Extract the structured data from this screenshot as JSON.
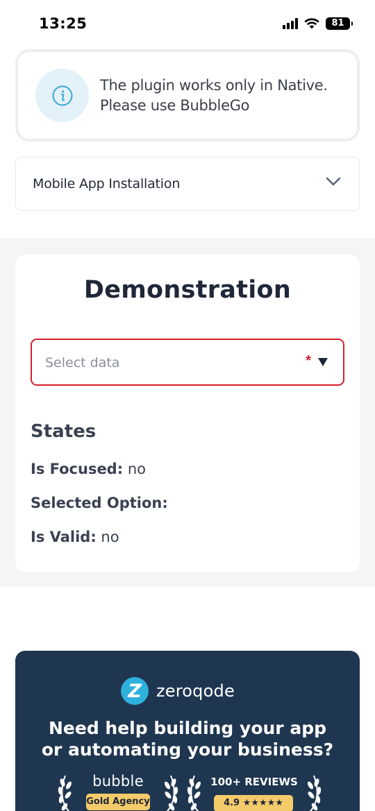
{
  "status_bar": {
    "time": "13:25",
    "battery": "81",
    "icons": [
      "signal-icon",
      "wifi-icon",
      "battery-icon"
    ]
  },
  "notice": {
    "icon": "info-icon",
    "line1": "The plugin works only in Native.",
    "line2": "Please use BubbleGo"
  },
  "install": {
    "label": "Mobile App Installation",
    "icon": "chevron-down-icon"
  },
  "demo": {
    "title": "Demonstration",
    "select": {
      "placeholder": "Select data",
      "required_mark": "*",
      "arrow_icon": "triangle-down-icon",
      "border_color": "#d61f2c"
    },
    "states": {
      "title": "States",
      "rows": [
        {
          "label": "Is Focused:",
          "value": "no"
        },
        {
          "label": "Selected Option:",
          "value": ""
        },
        {
          "label": "Is Valid:",
          "value": "no"
        }
      ]
    }
  },
  "promo": {
    "brand": "zeroqode",
    "headline_line1": "Need help building your app",
    "headline_line2": "or automating your business?",
    "badge1_title": "bubble",
    "badge1_pill": "Gold Agency",
    "badge2_title": "100+ REVIEWS",
    "badge2_pill": "4.9 ★★★★★",
    "background": "#1f3650",
    "accent": "#2fb1dd",
    "pill_color": "#f4cb6a"
  }
}
